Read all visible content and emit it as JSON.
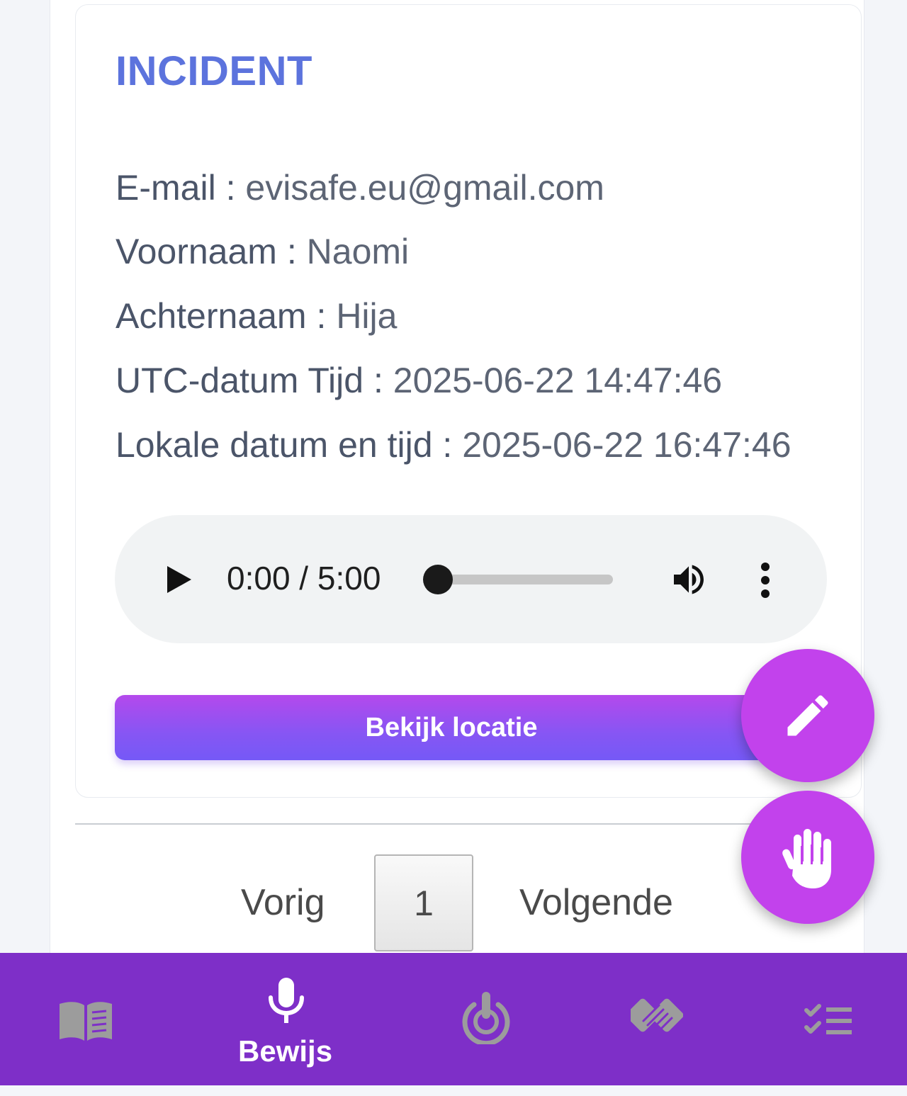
{
  "incident": {
    "title": "INCIDENT",
    "fields": [
      {
        "label": "E-mail",
        "value": "evisafe.eu@gmail.com"
      },
      {
        "label": "Voornaam",
        "value": "Naomi"
      },
      {
        "label": "Achternaam",
        "value": "Hija"
      },
      {
        "label": "UTC-datum Tijd",
        "value": "2025-06-22 14:47:46"
      },
      {
        "label": "Lokale datum en tijd",
        "value": "2025-06-22 16:47:46"
      }
    ],
    "separator": ":",
    "audio": {
      "time": "0:00 / 5:00",
      "progress_fraction": 0.0
    },
    "location_button": "Bekijk locatie"
  },
  "pagination": {
    "prev": "Vorig",
    "current_page": "1",
    "next": "Volgende"
  },
  "fabs": {
    "edit_icon": "pencil-icon",
    "stop_icon": "hand-icon"
  },
  "bottom_nav": {
    "active_index": 1,
    "items": [
      {
        "icon": "book-icon",
        "label": ""
      },
      {
        "icon": "microphone-icon",
        "label": "Bewijs"
      },
      {
        "icon": "panic-button-icon",
        "label": ""
      },
      {
        "icon": "handshake-icon",
        "label": ""
      },
      {
        "icon": "checklist-icon",
        "label": ""
      }
    ],
    "colors": {
      "background": "#7e2fc8",
      "active": "#ffffff",
      "inactive": "#9c9c9c"
    }
  },
  "colors": {
    "accent_title": "#5c73dd",
    "fab": "#c242ec",
    "button_gradient_top": "#b449ec",
    "button_gradient_bottom": "#7559f6"
  }
}
